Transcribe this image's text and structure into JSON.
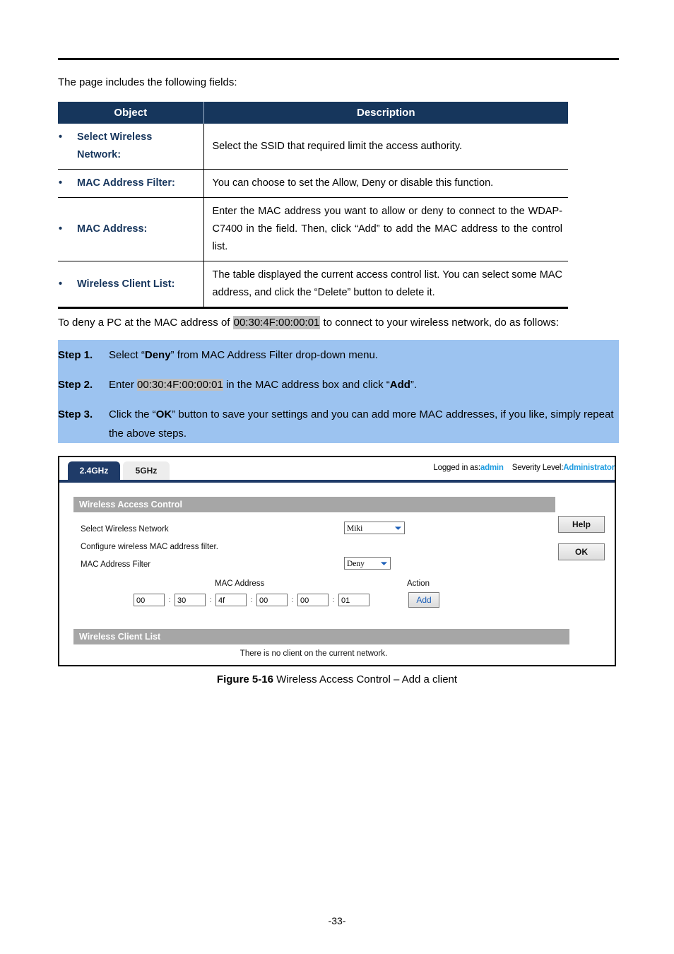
{
  "document": {
    "intro": "The page includes the following fields:",
    "page_number": "-33-"
  },
  "fields_table": {
    "headers": {
      "object": "Object",
      "description": "Description"
    },
    "rows": [
      {
        "object_line1": "Select Wireless",
        "object_line2": "Network:",
        "description": "Select the SSID that required limit the access authority."
      },
      {
        "object_line1": "MAC Address Filter:",
        "object_line2": "",
        "description": "You can choose to set the Allow, Deny or disable this function."
      },
      {
        "object_line1": "MAC Address:",
        "object_line2": "",
        "description": "Enter the MAC address you want to allow or deny to connect to the WDAP-C7400 in the field. Then, click “Add” to add the MAC address to the control list."
      },
      {
        "object_line1": "Wireless Client List:",
        "object_line2": "",
        "description": "The table displayed the current access control list. You can select some MAC address, and click the “Delete” button to delete it."
      }
    ]
  },
  "deny_sentence": {
    "before": "To deny a PC at the MAC address of ",
    "mac": "00:30:4F:00:00:01",
    "after": " to connect to your wireless network, do as follows:"
  },
  "steps": [
    {
      "label": "Step 1.",
      "parts": [
        {
          "text": "Select “",
          "style": "normal"
        },
        {
          "text": "Deny",
          "style": "bold"
        },
        {
          "text": "” from MAC Address Filter drop-down menu.",
          "style": "normal"
        }
      ]
    },
    {
      "label": "Step 2.",
      "parts": [
        {
          "text": "Enter ",
          "style": "normal"
        },
        {
          "text": "00:30:4F:00:00:01",
          "style": "highlight"
        },
        {
          "text": " in the MAC address box and click “",
          "style": "normal"
        },
        {
          "text": "Add",
          "style": "bold"
        },
        {
          "text": "”.",
          "style": "normal"
        }
      ]
    },
    {
      "label": "Step 3.",
      "parts": [
        {
          "text": "Click the “",
          "style": "normal"
        },
        {
          "text": "OK",
          "style": "bold"
        },
        {
          "text": "” button to save your settings and you can add more MAC addresses, if you like, simply repeat the above steps.",
          "style": "normal"
        }
      ]
    }
  ],
  "screenshot": {
    "tabs": [
      {
        "label": "2.4GHz",
        "active": true
      },
      {
        "label": "5GHz",
        "active": false
      }
    ],
    "login": {
      "logged_in_label": "Logged in as:",
      "logged_in_value": "admin",
      "severity_label": "Severity Level:",
      "severity_value": "Administrator",
      "accent_color": "#1C9BE0"
    },
    "access_section": {
      "title": "Wireless Access Control",
      "select_network_label": "Select Wireless Network",
      "select_network_value": "Miki",
      "config_note": "Configure wireless MAC address filter.",
      "mac_filter_label": "MAC Address Filter",
      "mac_filter_value": "Deny",
      "help_button": "Help",
      "ok_button": "OK",
      "mac_address_header": "MAC Address",
      "action_header": "Action",
      "mac_octets": [
        "00",
        "30",
        "4f",
        "00",
        "00",
        "01"
      ],
      "octet_separator": ":",
      "add_button": "Add"
    },
    "client_section": {
      "title": "Wireless Client List",
      "empty_message": "There is no client on the current network."
    },
    "colors": {
      "tab_active_bg": "#1F3B68",
      "tab_inactive_bg": "#EDEDED",
      "section_bar_bg": "#A6A6A6",
      "top_rule": "#1F3B68"
    }
  },
  "figure_caption": {
    "bold": "Figure 5-16",
    "rest": " Wireless Access Control – Add a client"
  },
  "theme": {
    "table_header_bg": "#16365C",
    "object_text": "#17365D",
    "steps_bg": "#9CC3F0",
    "highlight_bg": "#BFBFBF"
  }
}
